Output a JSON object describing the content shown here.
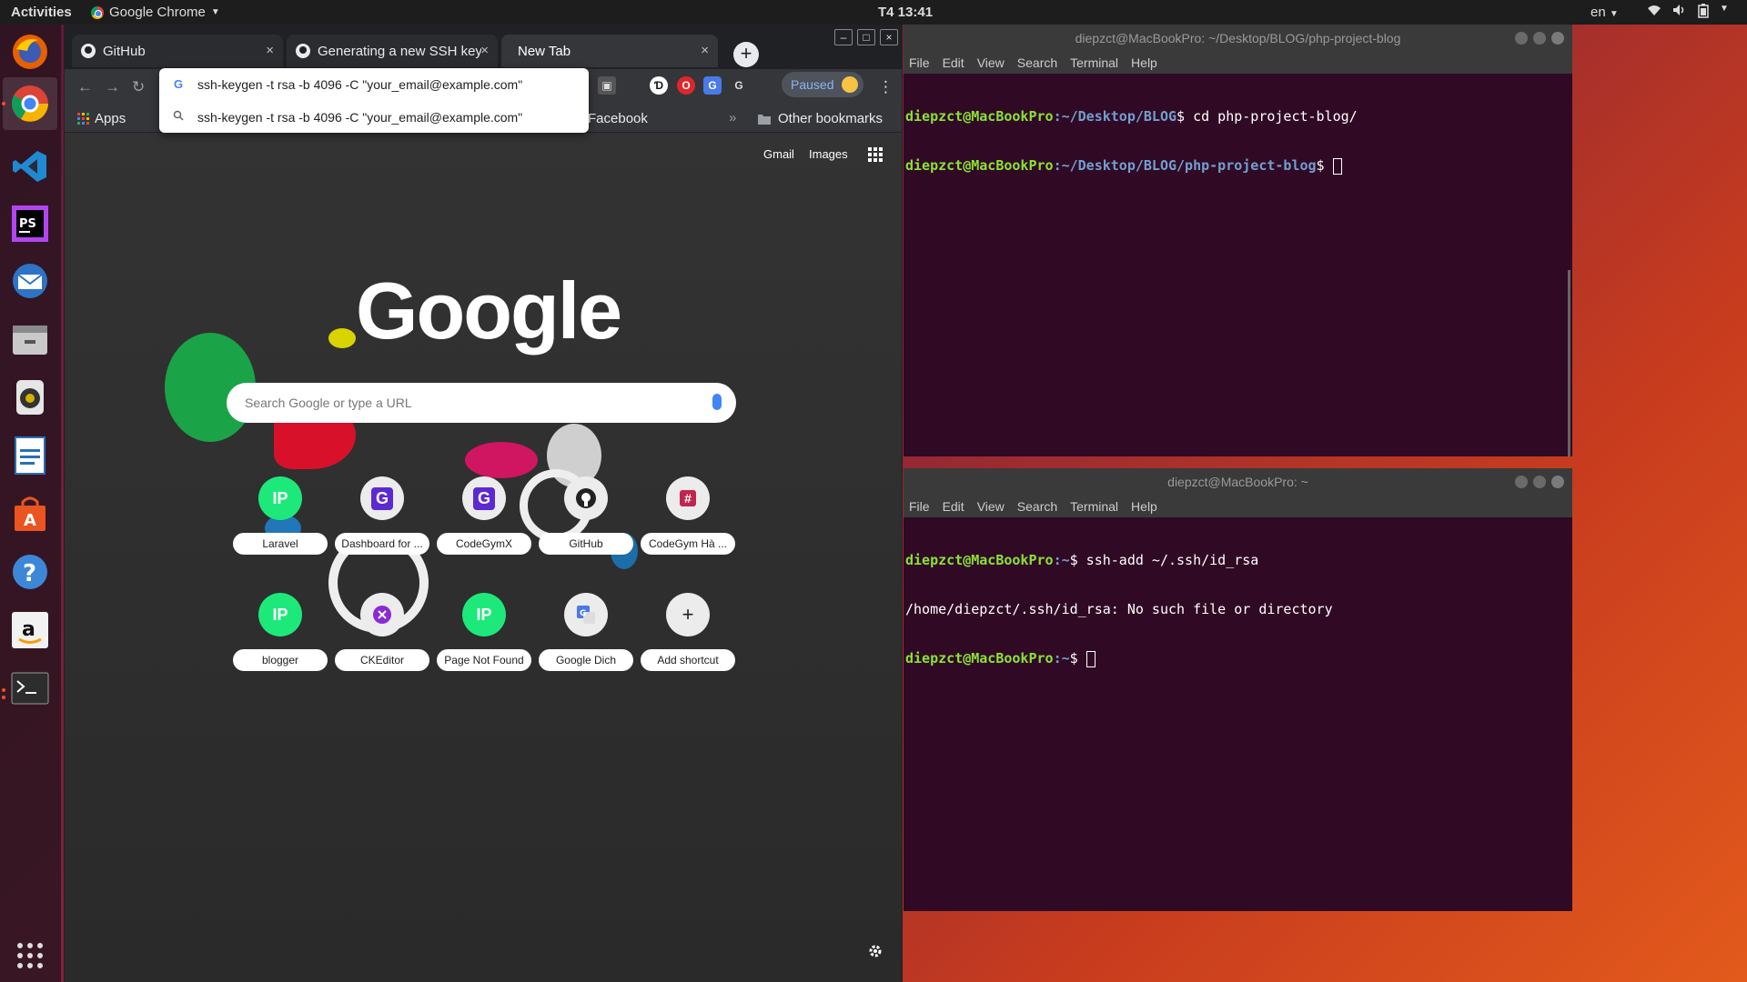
{
  "topbar": {
    "activities": "Activities",
    "app_menu": "Google Chrome",
    "clock": "T4 13:41",
    "language": "en"
  },
  "dock": {
    "items": [
      "Firefox",
      "Google Chrome",
      "Visual Studio Code",
      "PhpStorm",
      "Thunderbird",
      "Files",
      "Rhythmbox",
      "LibreOffice Writer",
      "Ubuntu Software",
      "Help",
      "Amazon",
      "Terminal"
    ],
    "show_apps": "Show Applications"
  },
  "chrome": {
    "tabs": [
      {
        "title": "GitHub",
        "close": "×"
      },
      {
        "title": "Generating a new SSH key",
        "close": "×"
      },
      {
        "title": "New Tab",
        "close": "×"
      }
    ],
    "new_tab": "+",
    "window_controls": [
      "–",
      "□",
      "×"
    ],
    "omnibox_suggestions": [
      "ssh-keygen -t rsa -b 4096 -C \"your_email@example.com\"",
      "ssh-keygen -t rsa -b 4096 -C \"your_email@example.com\""
    ],
    "profile_status": "Paused",
    "bookmarks": {
      "apps": "Apps",
      "facebook": "Facebook",
      "overflow": "»",
      "other": "Other bookmarks"
    },
    "ntp": {
      "gmail": "Gmail",
      "images": "Images",
      "logo": "Google",
      "search_placeholder": "Search Google or type a URL",
      "shortcuts": [
        {
          "label": "Laravel",
          "icon": "IP"
        },
        {
          "label": "Dashboard for ...",
          "icon": "G"
        },
        {
          "label": "CodeGymX",
          "icon": "G"
        },
        {
          "label": "GitHub",
          "icon": "github-icon"
        },
        {
          "label": "CodeGym Hà ...",
          "icon": "#"
        },
        {
          "label": "blogger",
          "icon": "IP"
        },
        {
          "label": "CKEditor",
          "icon": "ckeditor-icon"
        },
        {
          "label": "Page Not Found",
          "icon": "IP"
        },
        {
          "label": "Google Dich",
          "icon": "translate-icon"
        },
        {
          "label": "Add shortcut",
          "icon": "+"
        }
      ]
    }
  },
  "terminal_top": {
    "title": "diepzct@MacBookPro: ~/Desktop/BLOG/php-project-blog",
    "menu": [
      "File",
      "Edit",
      "View",
      "Search",
      "Terminal",
      "Help"
    ],
    "lines": [
      {
        "user": "diepzct@MacBookPro",
        "path": ":~/Desktop/BLOG",
        "cmd": "$ cd php-project-blog/"
      },
      {
        "user": "diepzct@MacBookPro",
        "path": ":~/Desktop/BLOG/php-project-blog",
        "cmd": "$ "
      }
    ]
  },
  "terminal_bottom": {
    "title": "diepzct@MacBookPro: ~",
    "menu": [
      "File",
      "Edit",
      "View",
      "Search",
      "Terminal",
      "Help"
    ],
    "line1_user": "diepzct@MacBookPro",
    "line1_path": ":~",
    "line1_cmd": "$ ssh-add ~/.ssh/id_rsa",
    "line2": "/home/diepzct/.ssh/id_rsa: No such file or directory",
    "line3_user": "diepzct@MacBookPro",
    "line3_path": ":~",
    "line3_cmd": "$ "
  },
  "colors": {
    "terminal_bg": "#300a24",
    "prompt_user": "#8ae234",
    "prompt_path": "#729fcf",
    "ubuntu_orange": "#e95420"
  }
}
